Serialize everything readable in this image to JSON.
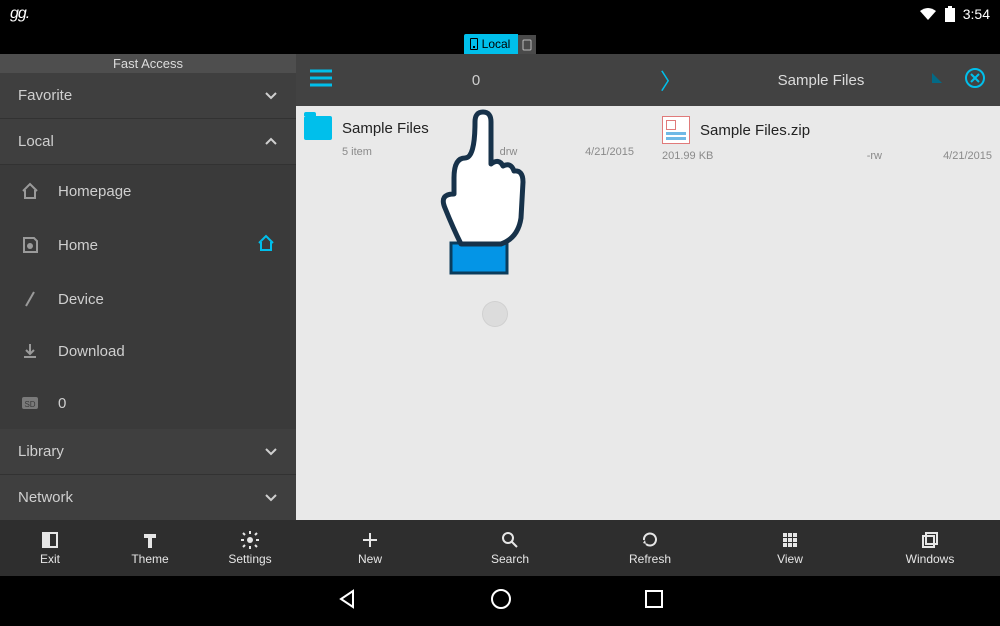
{
  "statusbar": {
    "brand": "gg.",
    "time": "3:54"
  },
  "tabs": {
    "active": "Local"
  },
  "sidebar": {
    "title": "Fast Access",
    "sections": {
      "favorite": "Favorite",
      "local": "Local",
      "library": "Library",
      "network": "Network"
    },
    "local_items": {
      "homepage": "Homepage",
      "home": "Home",
      "device": "Device",
      "download": "Download",
      "sd": "0"
    }
  },
  "breadcrumb": {
    "root": "0",
    "current": "Sample Files"
  },
  "files": [
    {
      "name": "Sample Files",
      "type": "folder",
      "info": "5 item",
      "perm": "drw",
      "date": "4/21/2015"
    },
    {
      "name": "Sample Files.zip",
      "type": "zip",
      "info": "201.99 KB",
      "perm": "-rw",
      "date": "4/21/2015"
    }
  ],
  "sidebar_actions": {
    "exit": "Exit",
    "theme": "Theme",
    "settings": "Settings"
  },
  "content_actions": {
    "new": "New",
    "search": "Search",
    "refresh": "Refresh",
    "view": "View",
    "windows": "Windows"
  }
}
